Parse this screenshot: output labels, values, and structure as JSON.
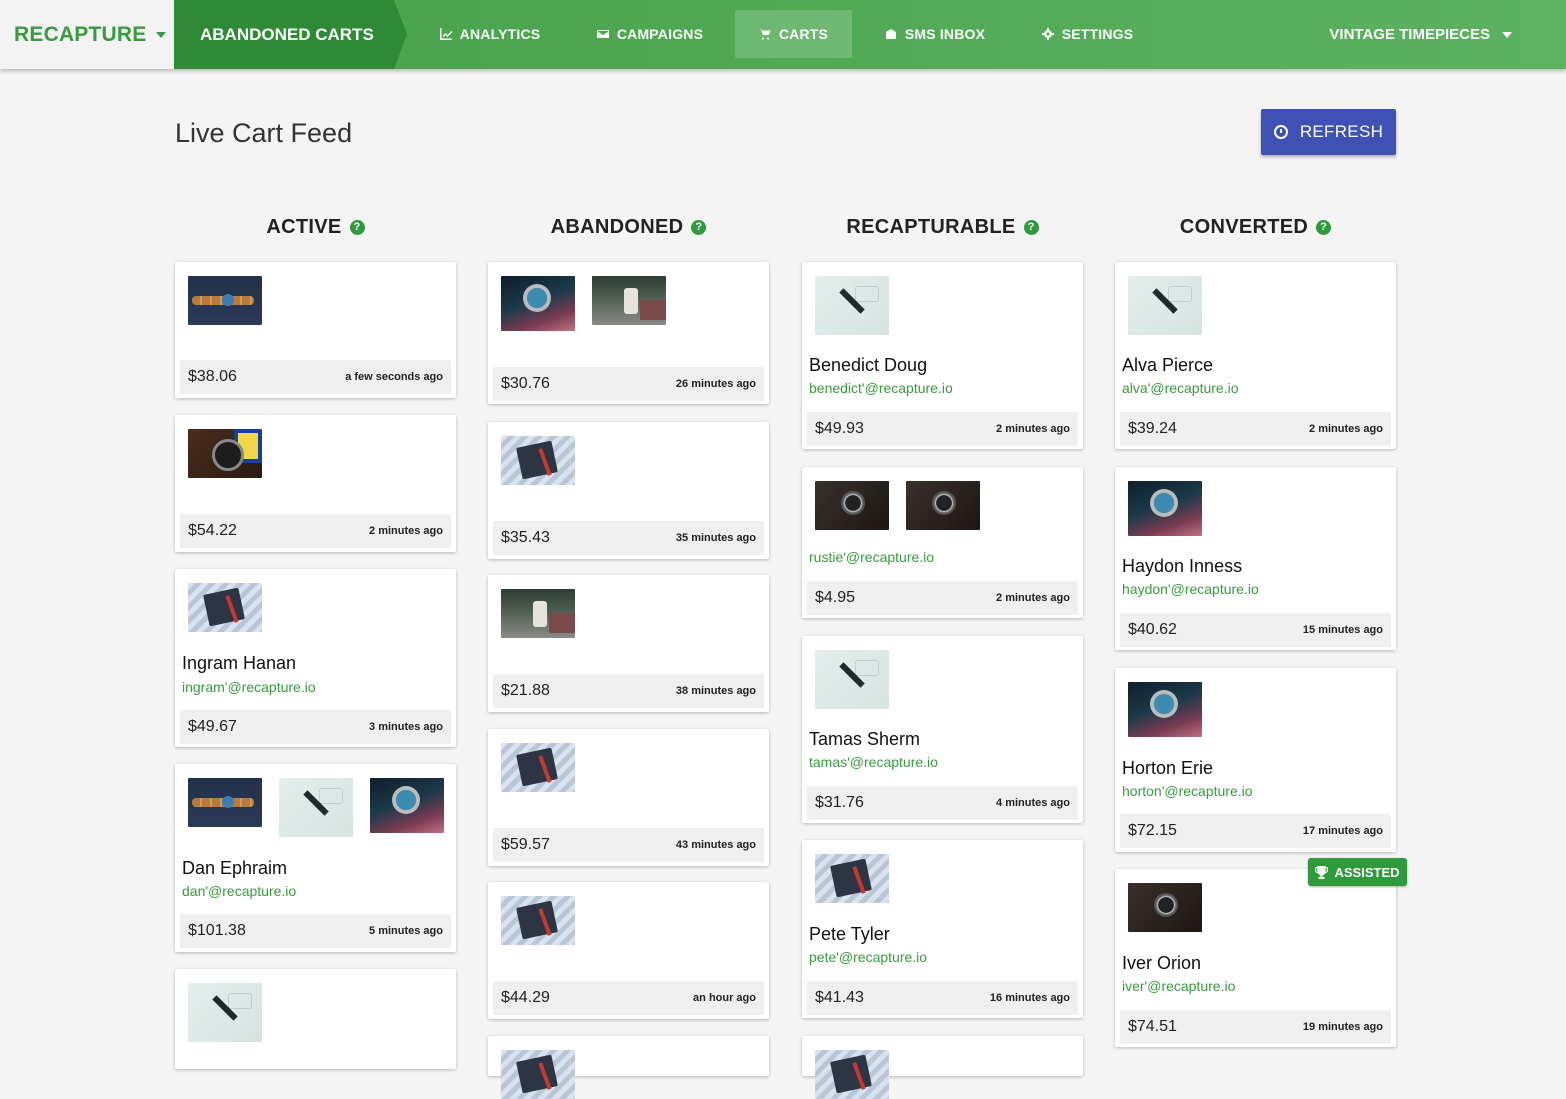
{
  "brand": {
    "name": "RECAPTURE"
  },
  "section": {
    "title": "ABANDONED CARTS"
  },
  "nav": {
    "analytics": "ANALYTICS",
    "campaigns": "CAMPAIGNS",
    "carts": "CARTS",
    "sms": "SMS INBOX",
    "settings": "SETTINGS",
    "store": "VINTAGE TIMEPIECES"
  },
  "page": {
    "title": "Live Cart Feed",
    "refresh": "REFRESH"
  },
  "columns": {
    "active": "ACTIVE",
    "abandoned": "ABANDONED",
    "recapturable": "RECAPTURABLE",
    "converted": "CONVERTED",
    "help": "?"
  },
  "cards": {
    "active": [
      {
        "price": "$38.06",
        "ago": "a few seconds ago"
      },
      {
        "price": "$54.22",
        "ago": "2 minutes ago"
      },
      {
        "name": "Ingram Hanan",
        "email": "ingram'@recapture.io",
        "price": "$49.67",
        "ago": "3 minutes ago"
      },
      {
        "name": "Dan Ephraim",
        "email": "dan'@recapture.io",
        "price": "$101.38",
        "ago": "5 minutes ago"
      }
    ],
    "abandoned": [
      {
        "price": "$30.76",
        "ago": "26 minutes ago"
      },
      {
        "price": "$35.43",
        "ago": "35 minutes ago"
      },
      {
        "price": "$21.88",
        "ago": "38 minutes ago"
      },
      {
        "price": "$59.57",
        "ago": "43 minutes ago"
      },
      {
        "price": "$44.29",
        "ago": "an hour ago"
      }
    ],
    "recapturable": [
      {
        "name": "Benedict Doug",
        "email": "benedict'@recapture.io",
        "price": "$49.93",
        "ago": "2 minutes ago"
      },
      {
        "email": "rustie'@recapture.io",
        "price": "$4.95",
        "ago": "2 minutes ago"
      },
      {
        "name": "Tamas Sherm",
        "email": "tamas'@recapture.io",
        "price": "$31.76",
        "ago": "4 minutes ago"
      },
      {
        "name": "Pete Tyler",
        "email": "pete'@recapture.io",
        "price": "$41.43",
        "ago": "16 minutes ago"
      }
    ],
    "converted": [
      {
        "name": "Alva Pierce",
        "email": "alva'@recapture.io",
        "price": "$39.24",
        "ago": "2 minutes ago"
      },
      {
        "name": "Haydon Inness",
        "email": "haydon'@recapture.io",
        "price": "$40.62",
        "ago": "15 minutes ago"
      },
      {
        "name": "Horton Erie",
        "email": "horton'@recapture.io",
        "price": "$72.15",
        "ago": "17 minutes ago"
      },
      {
        "name": "Iver Orion",
        "email": "iver'@recapture.io",
        "price": "$74.51",
        "ago": "19 minutes ago",
        "badge": "ASSISTED"
      }
    ]
  },
  "colors": {
    "green": "#43a047",
    "dark_green": "#2e8b35",
    "indigo": "#3f51b5"
  }
}
